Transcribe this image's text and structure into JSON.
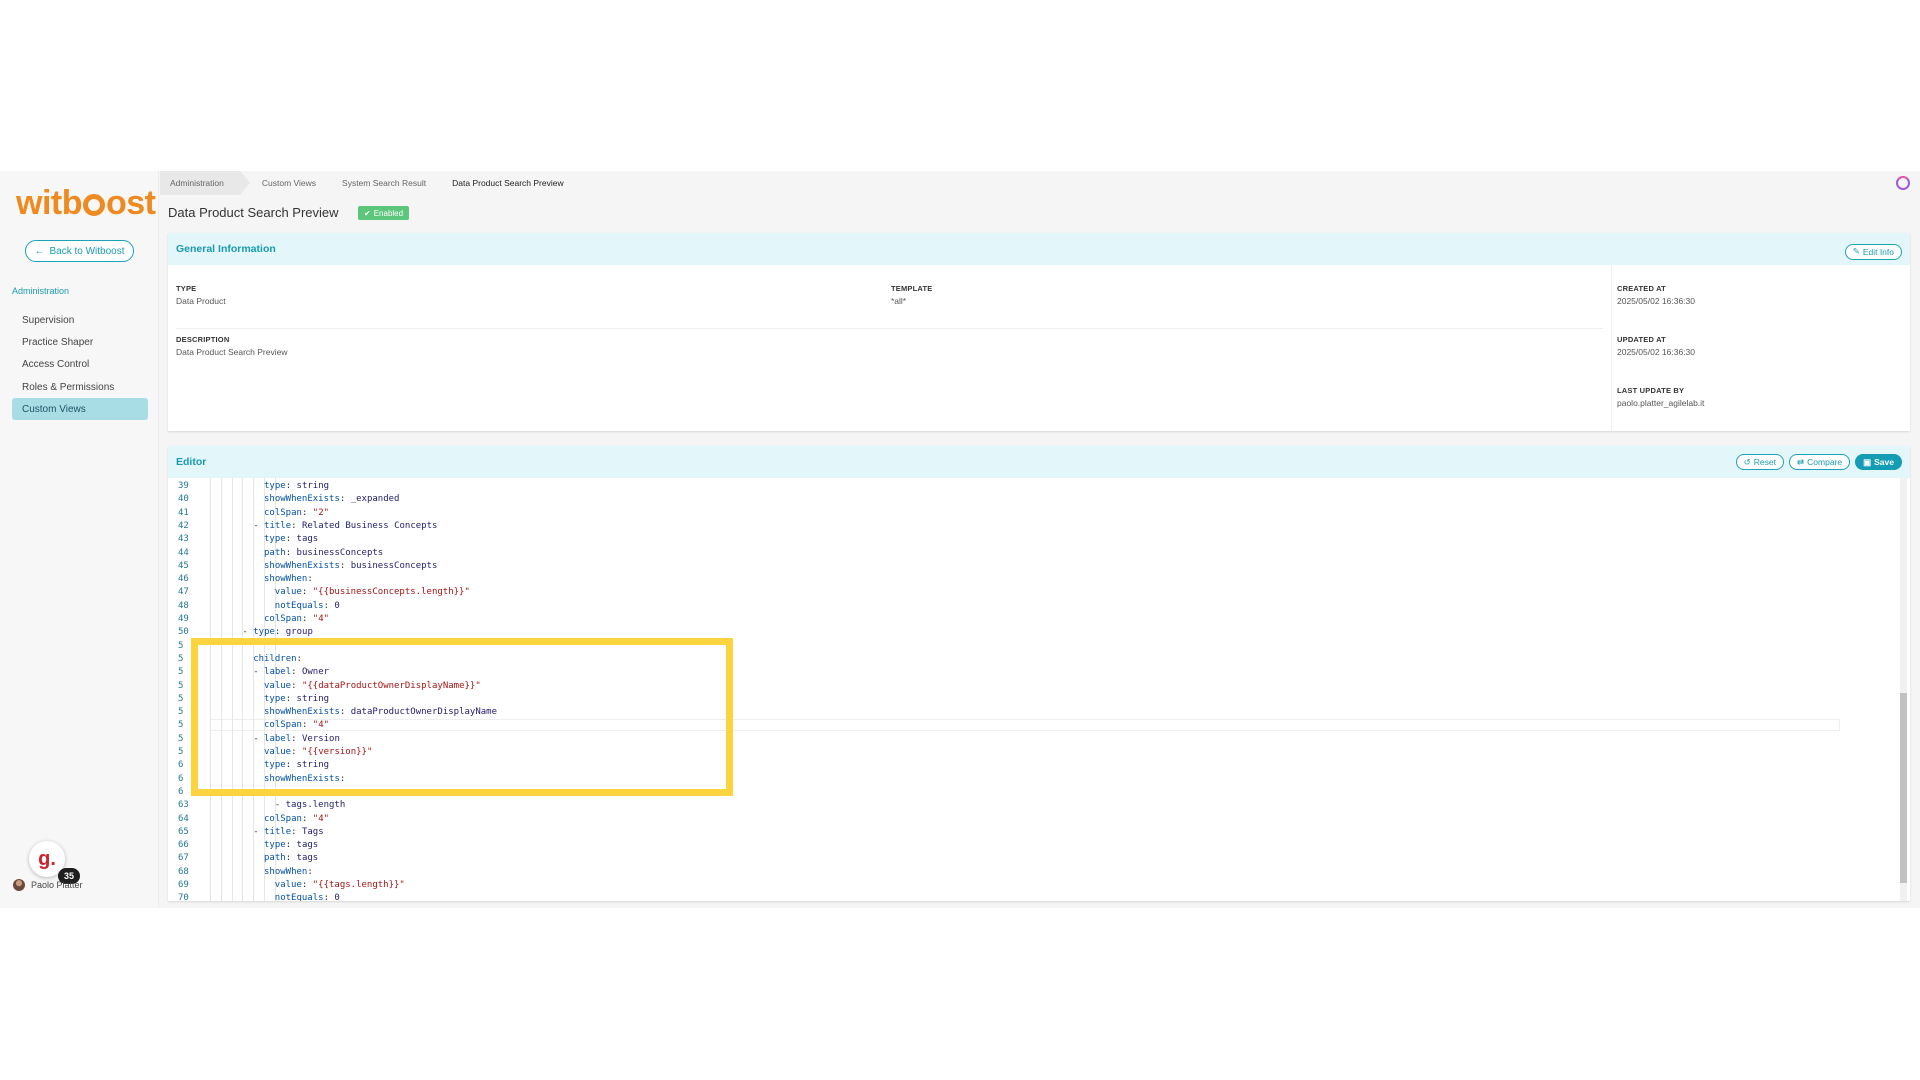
{
  "sidebar": {
    "logo": "witboost",
    "back_label": "Back to Witboost",
    "section": "Administration",
    "items": [
      {
        "label": "Supervision"
      },
      {
        "label": "Practice Shaper"
      },
      {
        "label": "Access Control"
      },
      {
        "label": "Roles & Permissions"
      },
      {
        "label": "Custom Views"
      }
    ],
    "badge_letter": "g.",
    "badge_count": "35",
    "user": "Paolo Platter"
  },
  "breadcrumb": [
    "Administration",
    "Custom Views",
    "System Search Result",
    "Data Product Search Preview"
  ],
  "page": {
    "title": "Data Product Search Preview",
    "status": "Enabled"
  },
  "general": {
    "title": "General Information",
    "edit_label": "Edit Info",
    "type_label": "TYPE",
    "type_value": "Data Product",
    "template_label": "TEMPLATE",
    "template_value": "*all*",
    "created_label": "CREATED AT",
    "created_value": "2025/05/02 16:36:30",
    "description_label": "DESCRIPTION",
    "description_value": "Data Product Search Preview",
    "updated_label": "UPDATED AT",
    "updated_value": "2025/05/02 16:36:30",
    "lastby_label": "LAST UPDATE BY",
    "lastby_value": "paolo.platter_agilelab.it"
  },
  "editor": {
    "title": "Editor",
    "reset_label": "Reset",
    "compare_label": "Compare",
    "save_label": "Save",
    "lines": [
      {
        "n": "39",
        "indent": 10,
        "key": "type",
        "val": "string"
      },
      {
        "n": "40",
        "indent": 10,
        "key": "showWhenExists",
        "val": "_expanded"
      },
      {
        "n": "41",
        "indent": 10,
        "key": "colSpan",
        "val": "\"2\"",
        "str": true
      },
      {
        "n": "42",
        "indent": 8,
        "dash": true,
        "key": "title",
        "val": "Related Business Concepts"
      },
      {
        "n": "43",
        "indent": 10,
        "key": "type",
        "val": "tags"
      },
      {
        "n": "44",
        "indent": 10,
        "key": "path",
        "val": "businessConcepts"
      },
      {
        "n": "45",
        "indent": 10,
        "key": "showWhenExists",
        "val": "businessConcepts"
      },
      {
        "n": "46",
        "indent": 10,
        "key": "showWhen",
        "val": ""
      },
      {
        "n": "47",
        "indent": 12,
        "key": "value",
        "val": "\"{{businessConcepts.length}}\"",
        "str": true
      },
      {
        "n": "48",
        "indent": 12,
        "key": "notEquals",
        "val": "0"
      },
      {
        "n": "49",
        "indent": 10,
        "key": "colSpan",
        "val": "\"4\"",
        "str": true
      },
      {
        "n": "50",
        "indent": 6,
        "dash": true,
        "key": "type",
        "val": "group"
      },
      {
        "n": "5",
        "indent": 8,
        "key": "",
        "val": ""
      },
      {
        "n": "5",
        "indent": 8,
        "key": "children",
        "val": ""
      },
      {
        "n": "5",
        "indent": 8,
        "dash": true,
        "key": "label",
        "val": "Owner"
      },
      {
        "n": "5",
        "indent": 10,
        "key": "value",
        "val": "\"{{dataProductOwnerDisplayName}}\"",
        "str": true
      },
      {
        "n": "5",
        "indent": 10,
        "key": "type",
        "val": "string"
      },
      {
        "n": "5",
        "indent": 10,
        "key": "showWhenExists",
        "val": "dataProductOwnerDisplayName"
      },
      {
        "n": "5",
        "indent": 10,
        "key": "colSpan",
        "val": "\"4\"",
        "str": true
      },
      {
        "n": "5",
        "indent": 8,
        "dash": true,
        "key": "label",
        "val": "Version"
      },
      {
        "n": "5",
        "indent": 10,
        "key": "value",
        "val": "\"{{version}}\"",
        "str": true
      },
      {
        "n": "6",
        "indent": 10,
        "key": "type",
        "val": "string"
      },
      {
        "n": "6",
        "indent": 10,
        "key": "showWhenExists",
        "val": ""
      },
      {
        "n": "6",
        "indent": 12,
        "key": "",
        "val": ""
      },
      {
        "n": "63",
        "indent": 12,
        "dash": true,
        "key": "",
        "val": "tags.length"
      },
      {
        "n": "64",
        "indent": 10,
        "key": "colSpan",
        "val": "\"4\"",
        "str": true
      },
      {
        "n": "65",
        "indent": 8,
        "dash": true,
        "key": "title",
        "val": "Tags"
      },
      {
        "n": "66",
        "indent": 10,
        "key": "type",
        "val": "tags"
      },
      {
        "n": "67",
        "indent": 10,
        "key": "path",
        "val": "tags"
      },
      {
        "n": "68",
        "indent": 10,
        "key": "showWhen",
        "val": ""
      },
      {
        "n": "69",
        "indent": 12,
        "key": "value",
        "val": "\"{{tags.length}}\"",
        "str": true
      },
      {
        "n": "70",
        "indent": 12,
        "key": "notEquals",
        "val": "0"
      }
    ]
  },
  "colors": {
    "accent": "#1a9bb0",
    "logo": "#ee8a1f",
    "enabled": "#5cc67a",
    "highlight": "#fcd440"
  }
}
